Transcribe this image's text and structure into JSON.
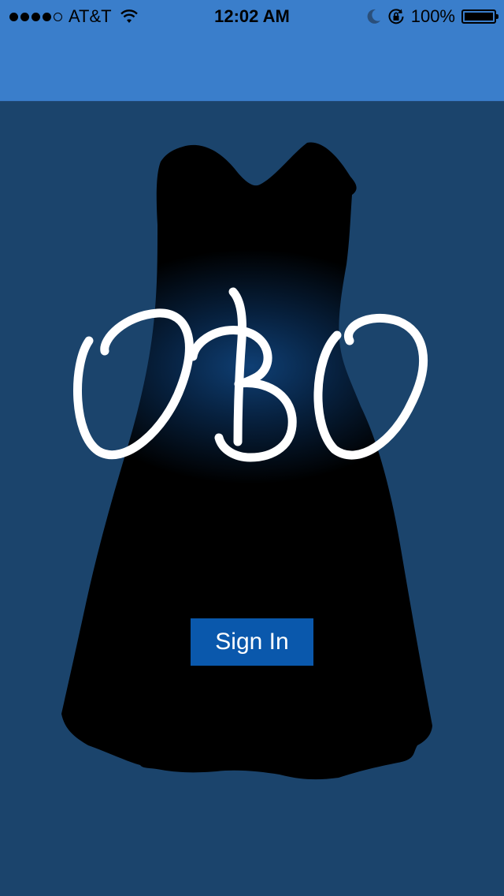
{
  "status_bar": {
    "carrier": "AT&T",
    "time": "12:02 AM",
    "battery_percent": "100%",
    "signal_bars_filled": 4,
    "signal_bars_total": 5,
    "icons": [
      "signal-dots-icon",
      "wifi-icon",
      "moon-icon",
      "rotation-lock-icon",
      "battery-icon"
    ]
  },
  "brand": {
    "logo_text": "OBO"
  },
  "actions": {
    "sign_in_label": "Sign In"
  },
  "colors": {
    "nav_bar": "#3a7ecb",
    "background": "#1b446c",
    "button": "#0a58ac",
    "dress": "#000000",
    "dress_glow": "#0d3a6c",
    "logo": "#ffffff"
  }
}
